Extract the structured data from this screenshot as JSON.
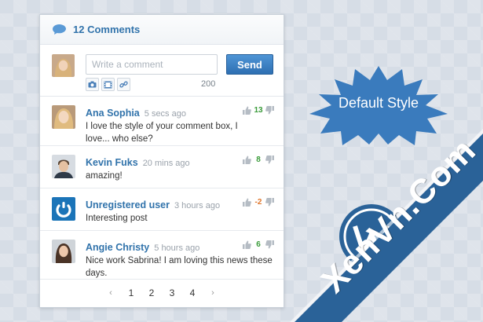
{
  "widget": {
    "title": "12 Comments",
    "compose": {
      "placeholder": "Write a comment",
      "send_label": "Send",
      "char_count": "200",
      "tools": [
        "camera-icon",
        "video-icon",
        "link-icon"
      ]
    },
    "comments": [
      {
        "author": "Ana Sophia",
        "time": "5 secs ago",
        "text": "I love the style of your comment box, I love... who else?",
        "score": "13",
        "score_sign": "pos"
      },
      {
        "author": "Kevin Fuks",
        "time": "20 mins ago",
        "text": "amazing!",
        "score": "8",
        "score_sign": "pos"
      },
      {
        "author": "Unregistered user",
        "time": "3 hours ago",
        "text": "Interesting post",
        "score": "-2",
        "score_sign": "neg"
      },
      {
        "author": "Angie Christy",
        "time": "5 hours ago",
        "text": "Nice work Sabrina! I am loving this news these days.",
        "score": "6",
        "score_sign": "pos"
      }
    ],
    "pagination": {
      "prev": "‹",
      "pages": [
        "1",
        "2",
        "3",
        "4"
      ],
      "next": "›"
    }
  },
  "badge": {
    "label": "Default Style"
  },
  "watermark": {
    "text": "XenVn.Com"
  },
  "colors": {
    "accent": "#3173ab",
    "badge": "#3a7bbd",
    "ribbon": "#2a6298",
    "positive": "#3a9b3a",
    "negative": "#e0762b"
  }
}
